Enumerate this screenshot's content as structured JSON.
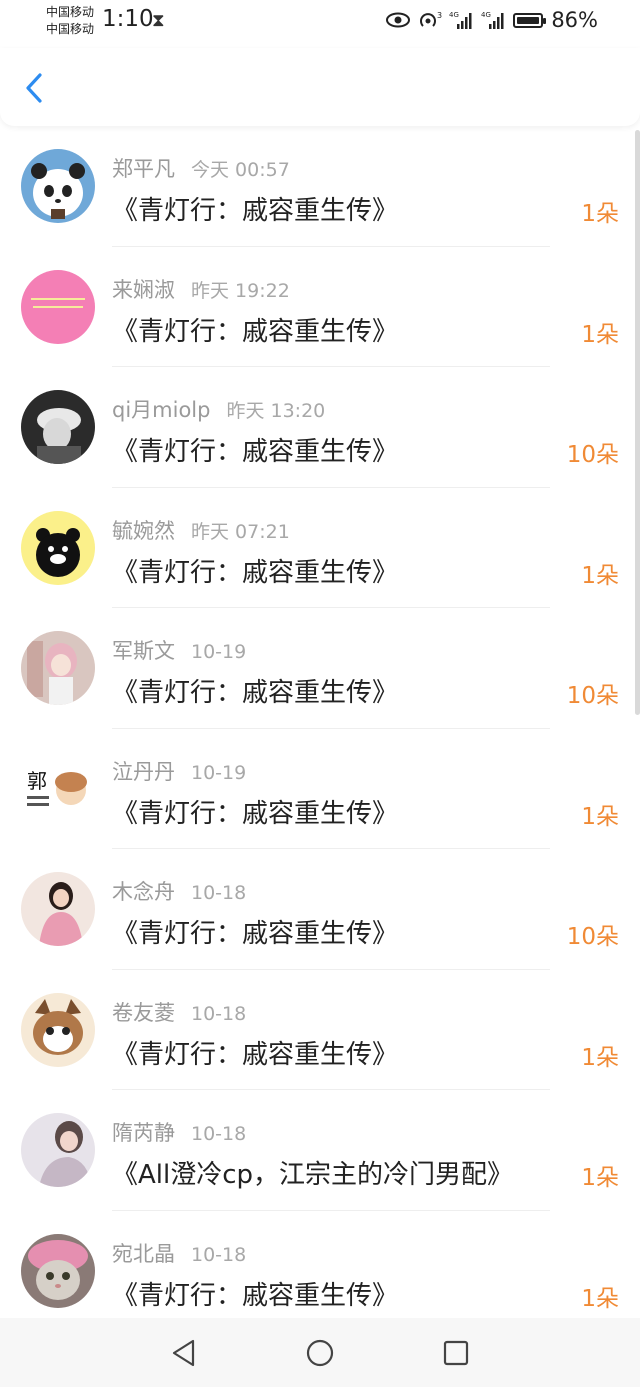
{
  "status_bar": {
    "carrier1": "中国移动",
    "carrier2": "中国移动",
    "time": "1:10",
    "battery": "86%",
    "icons": [
      "hourglass-icon",
      "eye-icon",
      "hotspot-icon",
      "signal-icon",
      "battery-icon"
    ]
  },
  "header": {
    "back_icon": "chevron-left-icon",
    "accent": "#2d8cf0"
  },
  "colors": {
    "count": "#f08a35",
    "name": "#9a9a9a",
    "title": "#222222"
  },
  "rows": [
    {
      "name": "郑平凡",
      "time": "今天 00:57",
      "title": "《青灯行：戚容重生传》",
      "count": "1朵",
      "avatar": "panda",
      "avatar_bg": "#6fa8d8"
    },
    {
      "name": "来娴淑",
      "time": "昨天 19:22",
      "title": "《青灯行：戚容重生传》",
      "count": "1朵",
      "avatar": "pink-text",
      "avatar_bg": "#f47fb5"
    },
    {
      "name": "qi月miolp",
      "time": "昨天 13:20",
      "title": "《青灯行：戚容重生传》",
      "count": "10朵",
      "avatar": "sketch-boy",
      "avatar_bg": "#555555"
    },
    {
      "name": "毓婉然",
      "time": "昨天 07:21",
      "title": "《青灯行：戚容重生传》",
      "count": "1朵",
      "avatar": "bear",
      "avatar_bg": "#fbf08a"
    },
    {
      "name": "军斯文",
      "time": "10-19",
      "title": "《青灯行：戚容重生传》",
      "count": "10朵",
      "avatar": "anime-girl",
      "avatar_bg": "#d9a9b0"
    },
    {
      "name": "泣丹丹",
      "time": "10-19",
      "title": "《青灯行：戚容重生传》",
      "count": "1朵",
      "avatar": "guo",
      "avatar_bg": "#ffffff"
    },
    {
      "name": "木念舟",
      "time": "10-18",
      "title": "《青灯行：戚容重生传》",
      "count": "10朵",
      "avatar": "girl-photo",
      "avatar_bg": "#e7a7b8"
    },
    {
      "name": "卷友菱",
      "time": "10-18",
      "title": "《青灯行：戚容重生传》",
      "count": "1朵",
      "avatar": "cat-cartoon",
      "avatar_bg": "#f3dcb8"
    },
    {
      "name": "隋芮静",
      "time": "10-18",
      "title": "《All澄冷cp，江宗主的冷门男配》",
      "count": "1朵",
      "avatar": "girl-soft",
      "avatar_bg": "#c8b8c8"
    },
    {
      "name": "宛北晶",
      "time": "10-18",
      "title": "《青灯行：戚容重生传》",
      "count": "1朵",
      "avatar": "cat-photo",
      "avatar_bg": "#a08a8a"
    }
  ],
  "nav": {
    "back": "back-triangle-icon",
    "home": "home-circle-icon",
    "recent": "recent-square-icon"
  }
}
